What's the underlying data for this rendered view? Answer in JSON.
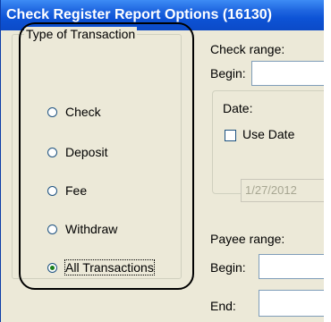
{
  "window": {
    "title": "Check Register Report Options (16130)"
  },
  "transaction_type": {
    "group_label": "Type of Transaction",
    "options": [
      {
        "label": "Check",
        "selected": false
      },
      {
        "label": "Deposit",
        "selected": false
      },
      {
        "label": "Fee",
        "selected": false
      },
      {
        "label": "Withdraw",
        "selected": false
      },
      {
        "label": "All Transactions",
        "selected": true
      }
    ]
  },
  "check_range": {
    "label": "Check range:",
    "begin_label": "Begin:",
    "begin_value": ""
  },
  "date": {
    "group_label": "Date:",
    "use_date_label": "Use Date",
    "use_date_checked": false,
    "date_value": "1/27/2012"
  },
  "payee_range": {
    "label": "Payee range:",
    "begin_label": "Begin:",
    "end_label": "End:"
  },
  "colors": {
    "titlebar": "#0d53d6",
    "window_bg": "#ece9d8",
    "highlight": "#000000"
  }
}
